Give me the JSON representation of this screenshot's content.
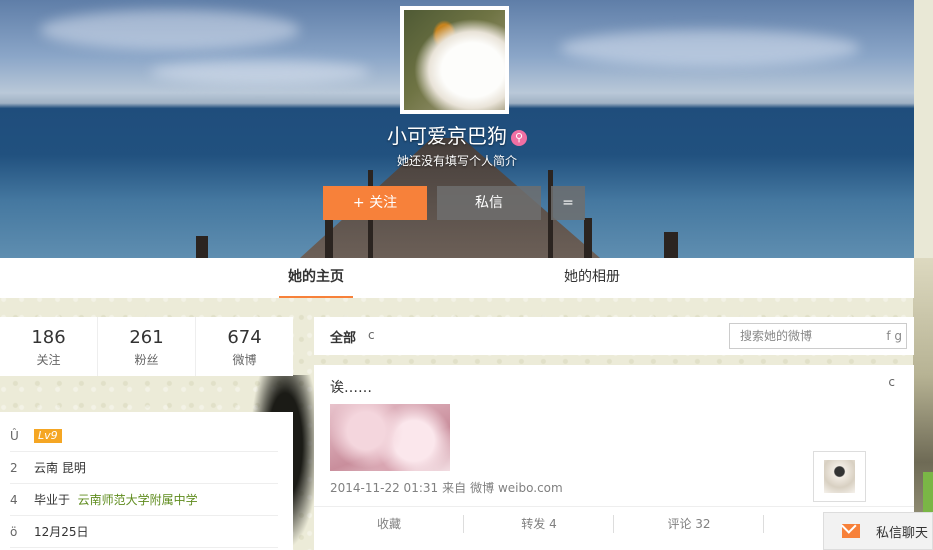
{
  "profile": {
    "nickname": "小可爱京巴狗",
    "gender_icon": "⚲",
    "intro": "她还没有填写个人简介",
    "follow_label": "+ 关注",
    "message_label": "私信",
    "more_label": "="
  },
  "tabs": [
    {
      "label": "她的主页"
    },
    {
      "label": "她的相册"
    }
  ],
  "stats": [
    {
      "value": "186",
      "label": "关注"
    },
    {
      "value": "261",
      "label": "粉丝"
    },
    {
      "value": "674",
      "label": "微博"
    }
  ],
  "info": {
    "rows": [
      {
        "icon": "Û",
        "text": "Lv9"
      },
      {
        "icon": "2",
        "text": "云南  昆明"
      },
      {
        "icon": "4",
        "prefix": "毕业于",
        "link": "云南师范大学附属中学"
      },
      {
        "icon": "ö",
        "text": "12月25日"
      }
    ]
  },
  "feed_filter": {
    "all_label": "全部",
    "filter_icon": "c",
    "search_placeholder": "搜索她的微博",
    "search_icon": "f g"
  },
  "post": {
    "text": "诶……",
    "collapse_icon": "c",
    "timestamp": "2014-11-22 01:31",
    "source_prefix": "来自",
    "source": "微博 weibo.com",
    "actions": [
      {
        "label": "收藏"
      },
      {
        "label": "转发  4"
      },
      {
        "label": "评论  32"
      },
      {
        "label": ""
      }
    ]
  },
  "chat": {
    "label": "私信聊天"
  },
  "colors": {
    "accent": "#f7813a",
    "link": "#5f8c1e",
    "badge": "#f5a623"
  }
}
